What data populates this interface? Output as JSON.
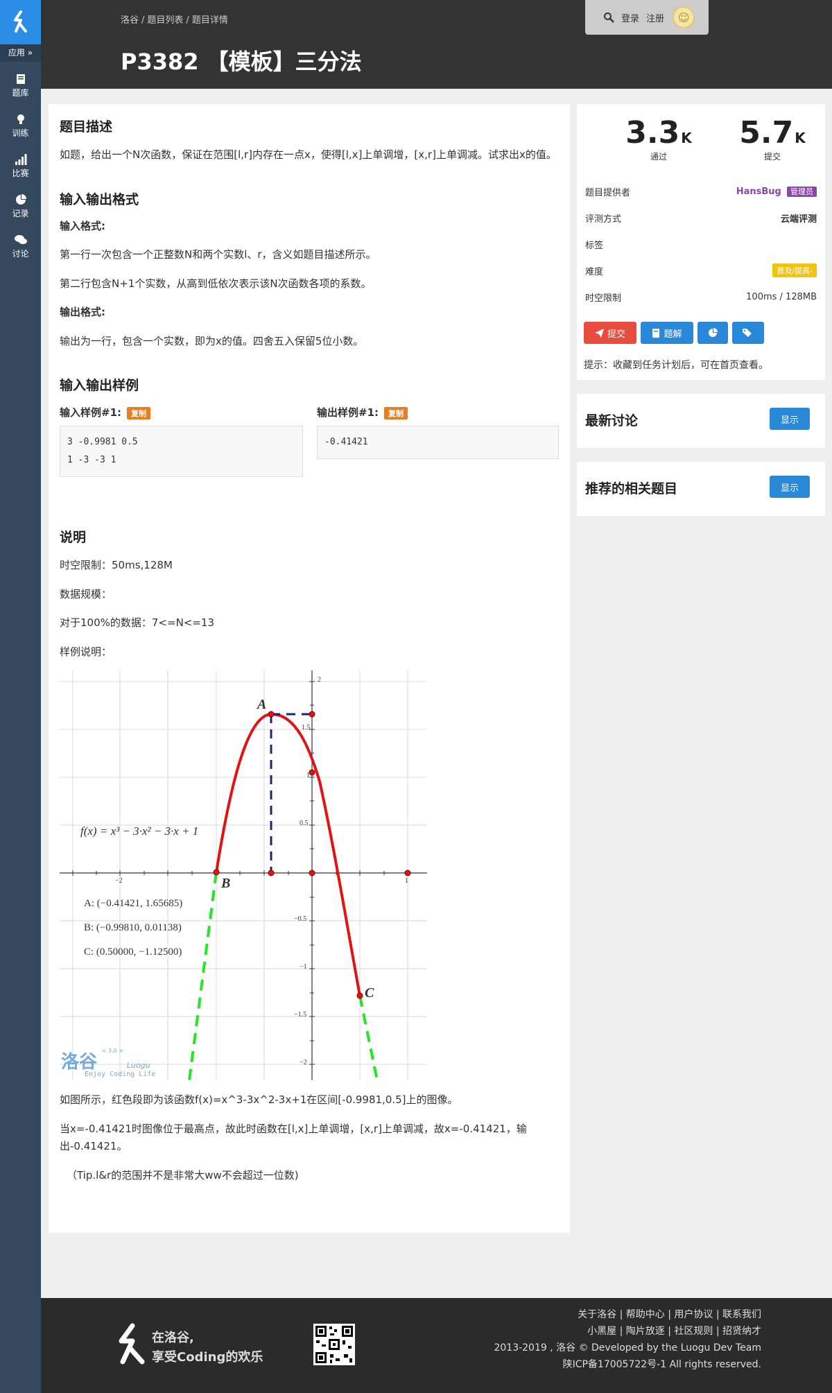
{
  "colors": {
    "sidebar": "#34495e",
    "accent": "#2a8ee6",
    "header": "#333333",
    "difficulty": "#f1c40f",
    "provider": "#8e44ad",
    "copy_badge": "#e67e22",
    "submit_red": "#e74c3c"
  },
  "sidebar": {
    "app_label": "应用 »",
    "items": [
      {
        "label": "题库",
        "icon": "book-icon"
      },
      {
        "label": "训练",
        "icon": "lightbulb-icon"
      },
      {
        "label": "比赛",
        "icon": "signal-bars-icon"
      },
      {
        "label": "记录",
        "icon": "pie-chart-icon"
      },
      {
        "label": "讨论",
        "icon": "chat-bubbles-icon"
      }
    ]
  },
  "header": {
    "breadcrumb": [
      "洛谷",
      "题目列表",
      "题目详情"
    ],
    "title": "P3382 【模板】三分法",
    "login": "登录",
    "register": "注册"
  },
  "problem": {
    "desc_title": "题目描述",
    "desc": "如题，给出一个N次函数，保证在范围[l,r]内存在一点x，使得[l,x]上单调增，[x,r]上单调减。试求出x的值。",
    "io_title": "输入输出格式",
    "input_label": "输入格式:",
    "input_line1": "第一行一次包含一个正整数N和两个实数l、r，含义如题目描述所示。",
    "input_line2": "第二行包含N+1个实数，从高到低依次表示该N次函数各项的系数。",
    "output_label": "输出格式:",
    "output_line": "输出为一行，包含一个实数，即为x的值。四舍五入保留5位小数。",
    "sample_title": "输入输出样例",
    "sample_in_label": "输入样例#1:",
    "sample_out_label": "输出样例#1:",
    "copy": "复制",
    "sample_in_1": "3 -0.9981 0.5",
    "sample_in_2": "1 -3 -3 1",
    "sample_out": "-0.41421",
    "note_title": "说明",
    "note_1": "时空限制：50ms,128M",
    "note_2": "数据规模：",
    "note_3": "对于100%的数据：7<=N<=13",
    "note_4": "样例说明：",
    "after_1": "如图所示，红色段即为该函数f(x)=x^3-3x^2-3x+1在区间[-0.9981,0.5]上的图像。",
    "after_2": "当x=-0.41421时图像位于最高点，故此时函数在[l,x]上单调增，[x,r]上单调减，故x=-0.41421，输出-0.41421。",
    "after_3": "（Tip.l&r的范围并不是非常大ww不会超过一位数)"
  },
  "figure": {
    "formula": "f(x) = x³ − 3·x² − 3·x + 1",
    "point_a_name": "A",
    "point_b_name": "B",
    "point_c_name": "C",
    "point_a": "A: (−0.41421, 1.65685)",
    "point_b": "B: (−0.99810, 0.01138)",
    "point_c": "C: (0.50000, −1.12500)",
    "ticks_x": [
      "−2",
      "1"
    ],
    "ticks_y": [
      "2",
      "1.5",
      "1",
      "0.5",
      "−0.5",
      "−1",
      "−1.5",
      "−2"
    ],
    "watermark_cn": "洛谷",
    "watermark_ver": "< 3.0 >",
    "watermark_en": "Luogu",
    "watermark_tag": "Enjoy Coding Life"
  },
  "stats": {
    "pass_num": "3.3",
    "pass_unit": "K",
    "pass_label": "通过",
    "submit_num": "5.7",
    "submit_unit": "K",
    "submit_label": "提交"
  },
  "info": {
    "provider_label": "题目提供者",
    "provider": "HansBug",
    "provider_badge": "管理员",
    "judge_label": "评测方式",
    "judge": "云端评测",
    "tags_label": "标签",
    "difficulty_label": "难度",
    "difficulty": "普及/提高-",
    "limit_label": "时空限制",
    "limit": "100ms / 128MB"
  },
  "actions": {
    "submit": "提交",
    "solution": "题解",
    "tip": "提示：收藏到任务计划后，可在首页查看。"
  },
  "discussion": {
    "title": "最新讨论",
    "show": "显示"
  },
  "related": {
    "title": "推荐的相关题目",
    "show": "显示"
  },
  "footer": {
    "slogan_1": "在洛谷,",
    "slogan_2": "享受Coding的欢乐",
    "links_1": [
      "关于洛谷",
      "帮助中心",
      "用户协议",
      "联系我们"
    ],
    "links_2": [
      "小黑屋",
      "陶片放逐",
      "社区规则",
      "招贤纳才"
    ],
    "copyright": "2013-2019 , 洛谷 © Developed by the Luogu Dev Team",
    "icp": "陕ICP备17005722号-1 All rights reserved."
  }
}
